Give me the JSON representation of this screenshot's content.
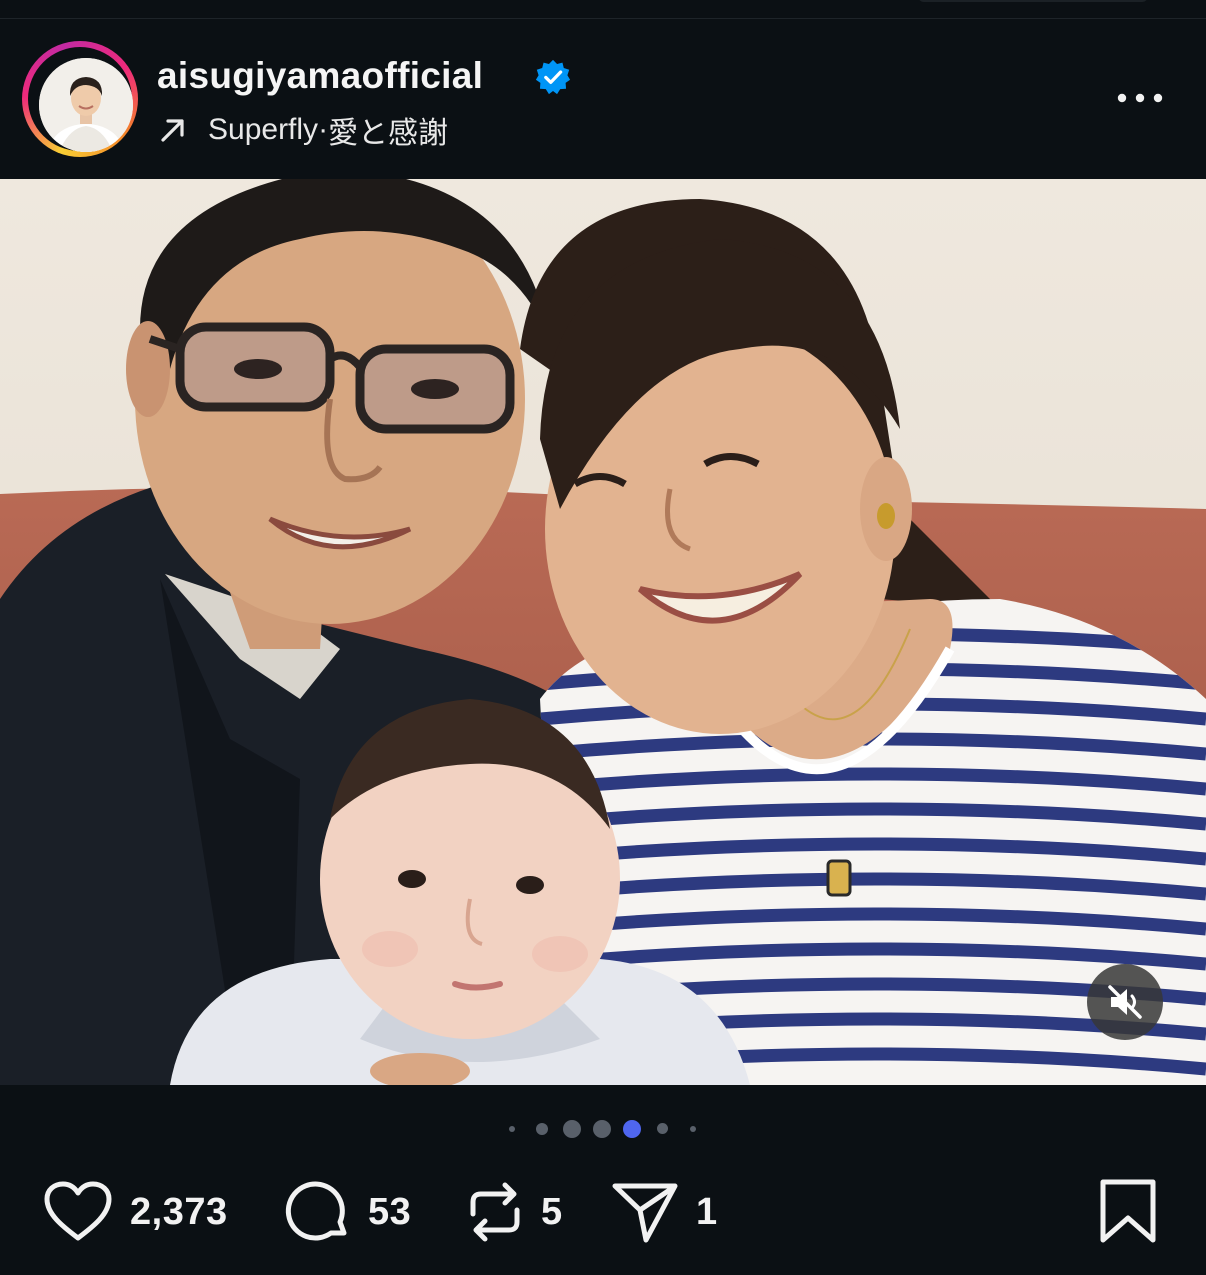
{
  "post": {
    "username": "aisugiyamaofficial",
    "verified": true,
    "audio": {
      "artist": "Superfly",
      "separator": " · ",
      "title": "愛と感謝"
    },
    "more_icon": "more-horizontal-icon"
  },
  "media": {
    "carousel_total_dots": 7,
    "carousel_active_index": 4,
    "muted": true,
    "mute_icon": "volume-muted-icon"
  },
  "actions": {
    "likes": "2,373",
    "comments": "53",
    "reposts": "5",
    "shares": "1"
  },
  "colors": {
    "background": "#0b1014",
    "accent_blue": "#4f66ef",
    "verified_blue": "#0095f6"
  }
}
